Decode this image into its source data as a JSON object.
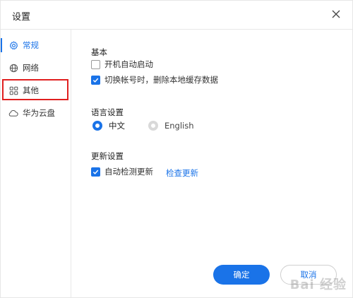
{
  "window": {
    "title": "设置"
  },
  "sidebar": {
    "items": [
      {
        "label": "常规",
        "icon": "gear-icon",
        "active": true
      },
      {
        "label": "网络",
        "icon": "globe-icon",
        "active": false
      },
      {
        "label": "其他",
        "icon": "grid-icon",
        "active": false
      },
      {
        "label": "华为云盘",
        "icon": "cloud-icon",
        "active": false
      }
    ]
  },
  "sections": {
    "basic": {
      "title": "基本",
      "options": [
        {
          "label": "开机自动启动",
          "checked": false
        },
        {
          "label": "切换帐号时，删除本地缓存数据",
          "checked": true
        }
      ]
    },
    "language": {
      "title": "语言设置",
      "options": [
        {
          "label": "中文",
          "selected": true
        },
        {
          "label": "English",
          "selected": false
        }
      ]
    },
    "update": {
      "title": "更新设置",
      "auto_check": {
        "label": "自动检测更新",
        "checked": true
      },
      "check_link": "检查更新"
    }
  },
  "buttons": {
    "confirm": "确定",
    "cancel": "取消"
  },
  "watermark": "Bai 经验",
  "colors": {
    "accent": "#1a73e8",
    "highlight": "#e02020"
  }
}
